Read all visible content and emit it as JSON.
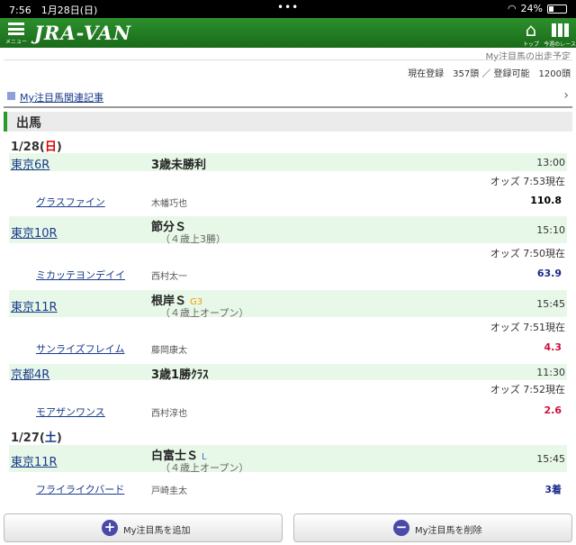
{
  "status_bar": {
    "time": "7:56",
    "date": "1月28日(日)",
    "dots": "•••",
    "battery": "24%"
  },
  "header": {
    "menu_label": "メニュー",
    "logo": "JRA-VAN",
    "top_label": "トップ",
    "races_label": "今週のレース"
  },
  "subtitle": "My注目馬の出走予定",
  "registration": "現在登録　357頭 ／ 登録可能　1200頭",
  "related_link": "My注目馬関連記事",
  "section_title": "出馬",
  "days": [
    {
      "date": "1/28",
      "dow": "日"
    },
    {
      "date": "1/27",
      "dow": "土"
    }
  ],
  "races": [
    {
      "venue": "東京6R",
      "name": "3歳未勝利",
      "grade": "",
      "condition": "",
      "time": "13:00",
      "odds_time": "オッズ 7:53現在",
      "horse": "グラスファイン",
      "jockey": "木幡巧也",
      "odds": "110.8",
      "odds_color": "#000000"
    },
    {
      "venue": "東京10R",
      "name": "節分Ｓ",
      "grade": "",
      "condition": "（４歳上3勝）",
      "time": "15:10",
      "odds_time": "オッズ 7:50現在",
      "horse": "ミカッテヨンデイイ",
      "jockey": "西村太一",
      "odds": "63.9",
      "odds_color": "#1a2b8a"
    },
    {
      "venue": "東京11R",
      "name": "根岸Ｓ",
      "grade": "G3",
      "condition": "（４歳上オープン）",
      "time": "15:45",
      "odds_time": "オッズ 7:51現在",
      "horse": "サンライズフレイム",
      "jockey": "藤岡康太",
      "odds": "4.3",
      "odds_color": "#d0103a"
    },
    {
      "venue": "京都4R",
      "name": "3歳1勝ｸﾗｽ",
      "grade": "",
      "condition": "",
      "time": "11:30",
      "odds_time": "オッズ 7:52現在",
      "horse": "モアザンワンス",
      "jockey": "西村淳也",
      "odds": "2.6",
      "odds_color": "#d0103a"
    },
    {
      "venue": "東京11R",
      "name": "白富士Ｓ",
      "grade": "L",
      "condition": "（４歳上オープン）",
      "time": "15:45",
      "odds_time": "",
      "horse": "フライライクバード",
      "jockey": "戸崎圭太",
      "odds": "3着",
      "odds_color": "#1a2b8a"
    }
  ],
  "buttons": {
    "add_label": "My注目馬を追加",
    "add_icon": "+",
    "remove_label": "My注目馬を削除",
    "remove_icon": "−"
  }
}
